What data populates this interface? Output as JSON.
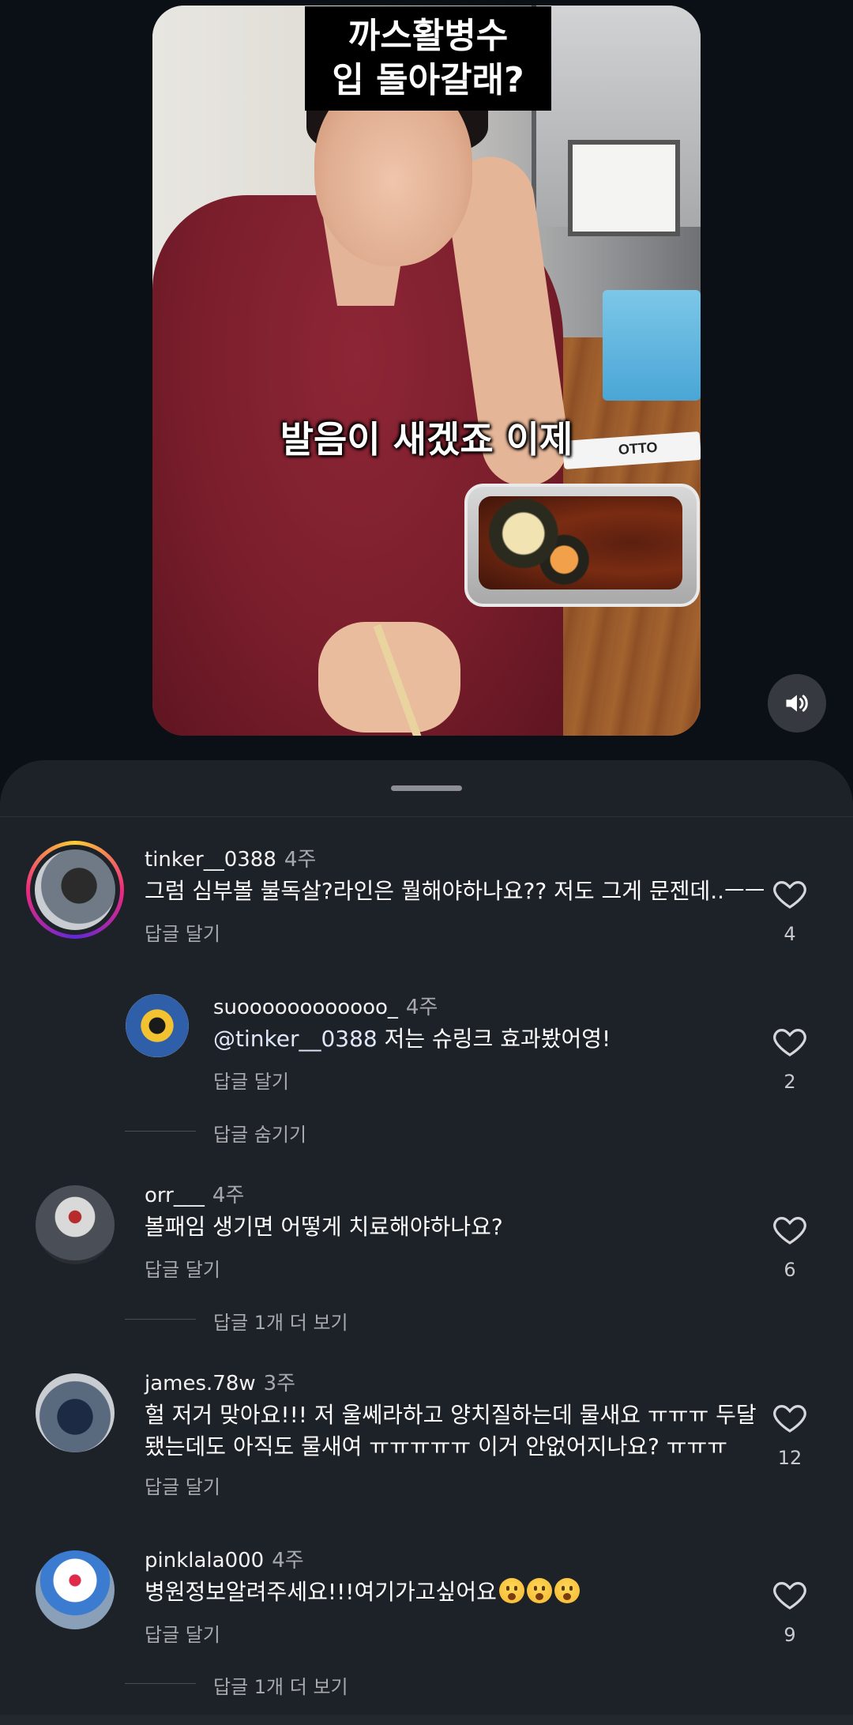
{
  "video": {
    "caption_top_line1": "까스활병수",
    "caption_top_line2": "입 돌아갈래?",
    "caption_mid": "발음이 새겠죠 이제",
    "product_label": "OTTO"
  },
  "comments": [
    {
      "username": "tinker__0388",
      "time": "4주",
      "text": "그럼 심부볼 불독살?라인은 뭘해야하나요?? 저도 그게 문젠데..ㅡㅡ",
      "reply_label": "답글 달기",
      "likes": "4"
    },
    {
      "username": "suoooooooooooo_",
      "time": "4주",
      "mention": "@tinker__0388",
      "text": " 저는 슈링크 효과봤어영!",
      "reply_label": "답글 달기",
      "likes": "2"
    },
    {
      "username": "orr___",
      "time": "4주",
      "text": "볼패임 생기면 어떻게 치료해야하나요?",
      "reply_label": "답글 달기",
      "likes": "6"
    },
    {
      "username": "james.78w",
      "time": "3주",
      "text_line1": "헐 저거 맞아요!!! 저 울쎄라하고 양치질하는데 물새요 ㅠㅠㅠ 두달",
      "text_line2": "됐는데도 아직도 물새여 ㅠㅠㅠㅠㅠ 이거 안없어지나요? ㅠㅠㅠ",
      "reply_label": "답글 달기",
      "likes": "12"
    },
    {
      "username": "pinklala000",
      "time": "4주",
      "text": "병원정보알려주세요!!!여기가고싶어요",
      "reply_label": "답글 달기",
      "likes": "9"
    }
  ],
  "thread_actions": {
    "hide_replies": "답글 숨기기",
    "view_more_1": "답글 1개 더 보기",
    "view_more_2": "답글 1개 더 보기"
  },
  "icons": {
    "sound": "speaker-icon",
    "like": "heart-outline-icon"
  }
}
